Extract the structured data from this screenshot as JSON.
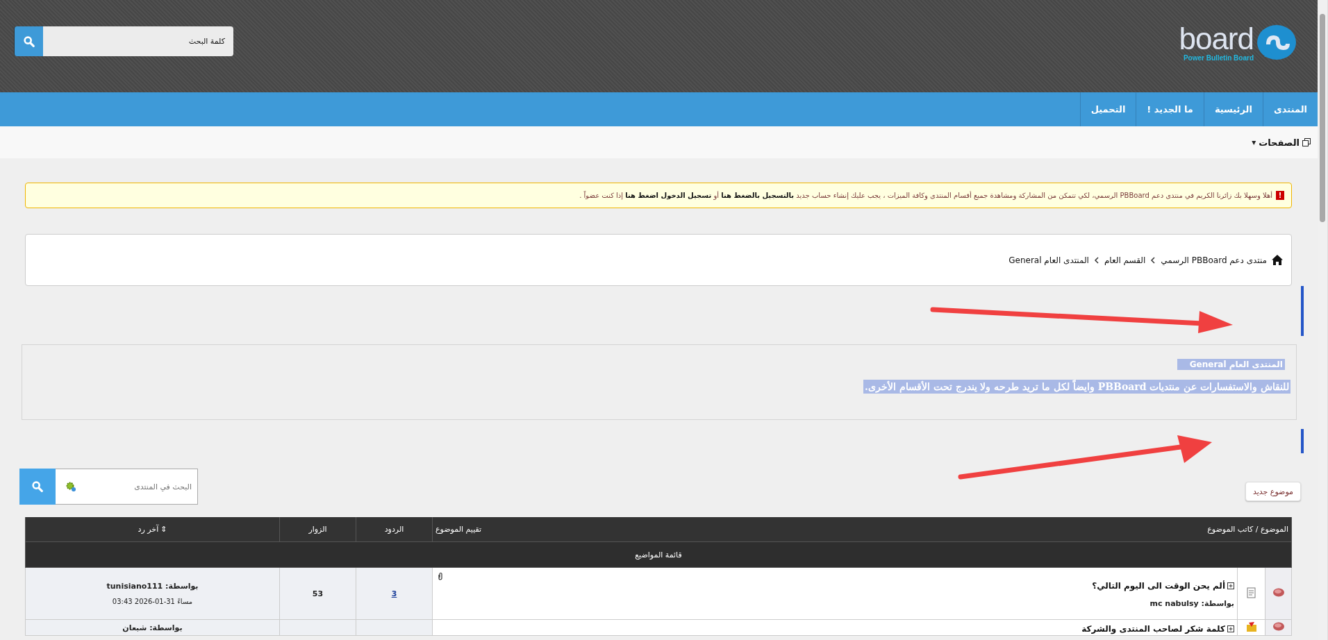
{
  "header": {
    "logo": {
      "word": "board",
      "tagline": "Power Bulletin Board"
    },
    "search": {
      "placeholder": "كلمة البحث"
    }
  },
  "nav": [
    {
      "label": "المنتدى"
    },
    {
      "label": "الرئيسية"
    },
    {
      "label": "ما الجديد !"
    },
    {
      "label": "التحميل"
    }
  ],
  "pages_menu": {
    "label": "الصفحات",
    "caret": "▾"
  },
  "notice": {
    "icon": "!",
    "text": "أهلا وسهلا بك زائرنا الكريم في منتدى دعم PBBoard الرسمي، لكي تتمكن من المشاركة ومشاهدة جميع أقسام المنتدى وكافة الميزات ، يجب عليك إنشاء حساب جديد **بالتسجيل بالضغط هنا** أو **تسجيل الدخول اضغط هنا** إذا كنت عضواً ."
  },
  "breadcrumb": [
    {
      "label": "منتدى دعم PBBoard الرسمي"
    },
    {
      "label": "القسم العام"
    },
    {
      "label": "المنتدى العام General"
    }
  ],
  "forum_info": {
    "title": "المنتدى العام General",
    "description": "للنقاش والاستفسارات عن منتديات PBBoard وايضاً لكل ما تريد طرحه ولا يندرج تحت الأقسام الأخرى."
  },
  "forum_search": {
    "placeholder": "البحث في المنتدى"
  },
  "new_topic_button": "موضوع جديد",
  "table": {
    "columns": [
      {
        "label": "الموضوع / كاتب الموضوع"
      },
      {
        "label": "تقييم الموضوع"
      },
      {
        "label": "الردود"
      },
      {
        "label": "الزوار"
      },
      {
        "label": "آخر رد",
        "sort_icon": "⇕"
      }
    ],
    "section_title": "قائمة المواضيع",
    "rows": [
      {
        "kind": "normal",
        "title": "ألم يحن الوقت الى اليوم التالي؟",
        "author_label": "بواسطة:",
        "author": "mc nabulsy",
        "has_attachment": true,
        "replies": "3",
        "views": "53",
        "last_by_label": "بواسطة:",
        "last_by": "tunisiano111",
        "last_date": "مساءً 31-01-2026 03:43"
      },
      {
        "kind": "hot",
        "title": "كلمة شكر لصاحب المنتدى والشركة",
        "has_attachment": false,
        "last_by_label": "بواسطة:",
        "last_by": "شبعان"
      }
    ]
  }
}
